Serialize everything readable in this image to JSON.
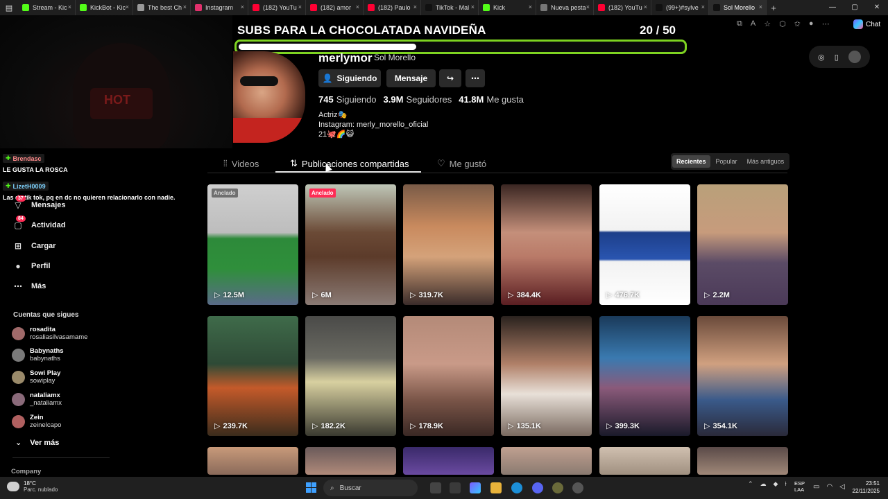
{
  "browser": {
    "tabs": [
      {
        "label": "Stream - Kic",
        "color": "#53fc18"
      },
      {
        "label": "KickBot - Kic",
        "color": "#53fc18"
      },
      {
        "label": "The best Ch",
        "color": "#9a9a9a"
      },
      {
        "label": "Instagram",
        "color": "#e1306c"
      },
      {
        "label": "(182) YouTu",
        "color": "#ff0033"
      },
      {
        "label": "(182) amor",
        "color": "#ff0033"
      },
      {
        "label": "(182) Paulo",
        "color": "#ff0033"
      },
      {
        "label": "TikTok - Mal",
        "color": "#111111"
      },
      {
        "label": "Kick",
        "color": "#53fc18"
      },
      {
        "label": "Nueva pesta",
        "color": "#777777"
      },
      {
        "label": "(182) YouTu",
        "color": "#ff0033"
      },
      {
        "label": "(99+)#sylve",
        "color": "#111111"
      },
      {
        "label": "Sol Morello",
        "color": "#111111"
      }
    ],
    "new_tab": "+",
    "chat_label": "Chat"
  },
  "overlay": {
    "goal_title": "SUBS PARA LA CHOCOLATADA NAVIDEÑA",
    "goal_current": "20",
    "goal_separator": " / ",
    "goal_total": "50",
    "goal_progress": 0.4,
    "goal_color": "#7ed321",
    "cam_mask_text": "HOT",
    "chat": [
      {
        "user": "Brendasc",
        "user_color": "#ff8a8a",
        "text": "LE GUSTA LA ROSCA"
      },
      {
        "user": "LizetH0009",
        "user_color": "#7ed3ff",
        "text": "Las de tik tok, pq en dc no quieren relacionarlo con nadie."
      }
    ]
  },
  "profile": {
    "username": "merlymor",
    "nickname": "Sol Morello",
    "buttons": {
      "following": "Siguiendo",
      "message": "Mensaje"
    },
    "stats": {
      "following_count": "745",
      "following_label": "Siguiendo",
      "followers_count": "3.9M",
      "followers_label": "Seguidores",
      "likes_count": "41.8M",
      "likes_label": "Me gusta"
    },
    "bio": {
      "line1": "Actriz🎭",
      "line2": "Instagram: merly_morello_oficial",
      "line3": "21🐙🌈😺"
    }
  },
  "tabs": {
    "videos": "Videos",
    "reposts": "Publicaciones compartidas",
    "liked": "Me gustó"
  },
  "sort": {
    "recent": "Recientes",
    "popular": "Popular",
    "oldest": "Más antiguos"
  },
  "nav": {
    "messages": "Mensajes",
    "messages_badge": "37",
    "activity": "Actividad",
    "activity_badge": "84",
    "upload": "Cargar",
    "profile": "Perfil",
    "more": "Más",
    "following_title": "Cuentas que sigues",
    "following": [
      {
        "name": "rosadita",
        "handle": "rosaliasilvasamame",
        "color": "#a06a6a"
      },
      {
        "name": "Babynaths",
        "handle": "babynaths",
        "color": "#7a7a7a"
      },
      {
        "name": "Sowi Play",
        "handle": "sowiplay",
        "color": "#9a8a6a"
      },
      {
        "name": "nataliamx",
        "handle": "_nataliamx",
        "color": "#8a6a7a"
      },
      {
        "name": "Zein",
        "handle": "zeinelcapo",
        "color": "#b06060"
      }
    ],
    "see_more": "Ver más",
    "company": "Company"
  },
  "videos": {
    "pinned_label": "Anclado",
    "row1": [
      {
        "views": "12.5M",
        "pinned": true,
        "bg": "linear-gradient(180deg,#cfcfcf 0%,#bdbdbd 40%,#2d8a3a 45%,#2f8f3b 70%,#5a6b88 100%)"
      },
      {
        "views": "6M",
        "pinned": true,
        "bg": "linear-gradient(180deg,#bfc7b8 0%,#6b4a36 40%,#5c3b2a 60%,#8a7a74 100%)"
      },
      {
        "views": "319.7K",
        "pinned": false,
        "bg": "linear-gradient(180deg,#7a5b47 0%,#c98a5e 35%,#d4a27a 60%,#3b2c2a 100%)"
      },
      {
        "views": "384.4K",
        "pinned": false,
        "bg": "linear-gradient(180deg,#3a2622 0%,#c48f7a 40%,#b97a68 60%,#5a1e22 100%)"
      },
      {
        "views": "476.7K",
        "pinned": false,
        "bg": "linear-gradient(180deg,#ffffff 0%,#f2f2f2 38%,#1d3f8a 40%,#2a55b0 62%,#f2f2f2 64%,#ffffff 100%)"
      },
      {
        "views": "2.2M",
        "pinned": false,
        "bg": "linear-gradient(180deg,#b9a07a 0%,#c79b7c 40%,#5b4b66 65%,#4b3a58 100%)"
      }
    ],
    "row2": [
      {
        "views": "239.7K",
        "bg": "linear-gradient(180deg,#3f6b4a 0%,#2e4a36 40%,#c45a2a 60%,#3b2c1c 100%)"
      },
      {
        "views": "182.2K",
        "bg": "linear-gradient(180deg,#4a4a48 0%,#6a6a62 35%,#d8d0a0 55%,#3a3a30 100%)"
      },
      {
        "views": "178.9K",
        "bg": "linear-gradient(180deg,#b48a78 0%,#c99a88 40%,#7a5548 70%,#3a2824 100%)"
      },
      {
        "views": "135.1K",
        "bg": "linear-gradient(180deg,#2a221e 0%,#b08068 40%,#e8e0d8 65%,#7a6a60 100%)"
      },
      {
        "views": "399.3K",
        "bg": "linear-gradient(180deg,#1a3a5a 0%,#3a7ab0 35%,#8a5a7a 60%,#1a1a2a 100%)"
      },
      {
        "views": "354.1K",
        "bg": "linear-gradient(180deg,#6a4a3a 0%,#d0a080 40%,#3a5a8a 70%,#2a2a3a 100%)"
      }
    ],
    "row3": [
      {
        "bg": "linear-gradient(180deg,#c89a7a,#8a6a5a)"
      },
      {
        "bg": "linear-gradient(180deg,#6a5a5a,#b08a7a)"
      },
      {
        "bg": "linear-gradient(180deg,#3a2a6a,#6a4aa0)"
      },
      {
        "bg": "linear-gradient(180deg,#c0a090,#8a7a70)"
      },
      {
        "bg": "linear-gradient(180deg,#d0c0b0,#a09080)"
      },
      {
        "bg": "linear-gradient(180deg,#5a4a48,#a08878)"
      }
    ]
  },
  "taskbar": {
    "temp": "18°C",
    "weather": "Parc. nublado",
    "search": "Buscar",
    "lang_line1": "ESP",
    "lang_line2": "LAA",
    "time": "23:51",
    "date": "22/11/2025"
  }
}
